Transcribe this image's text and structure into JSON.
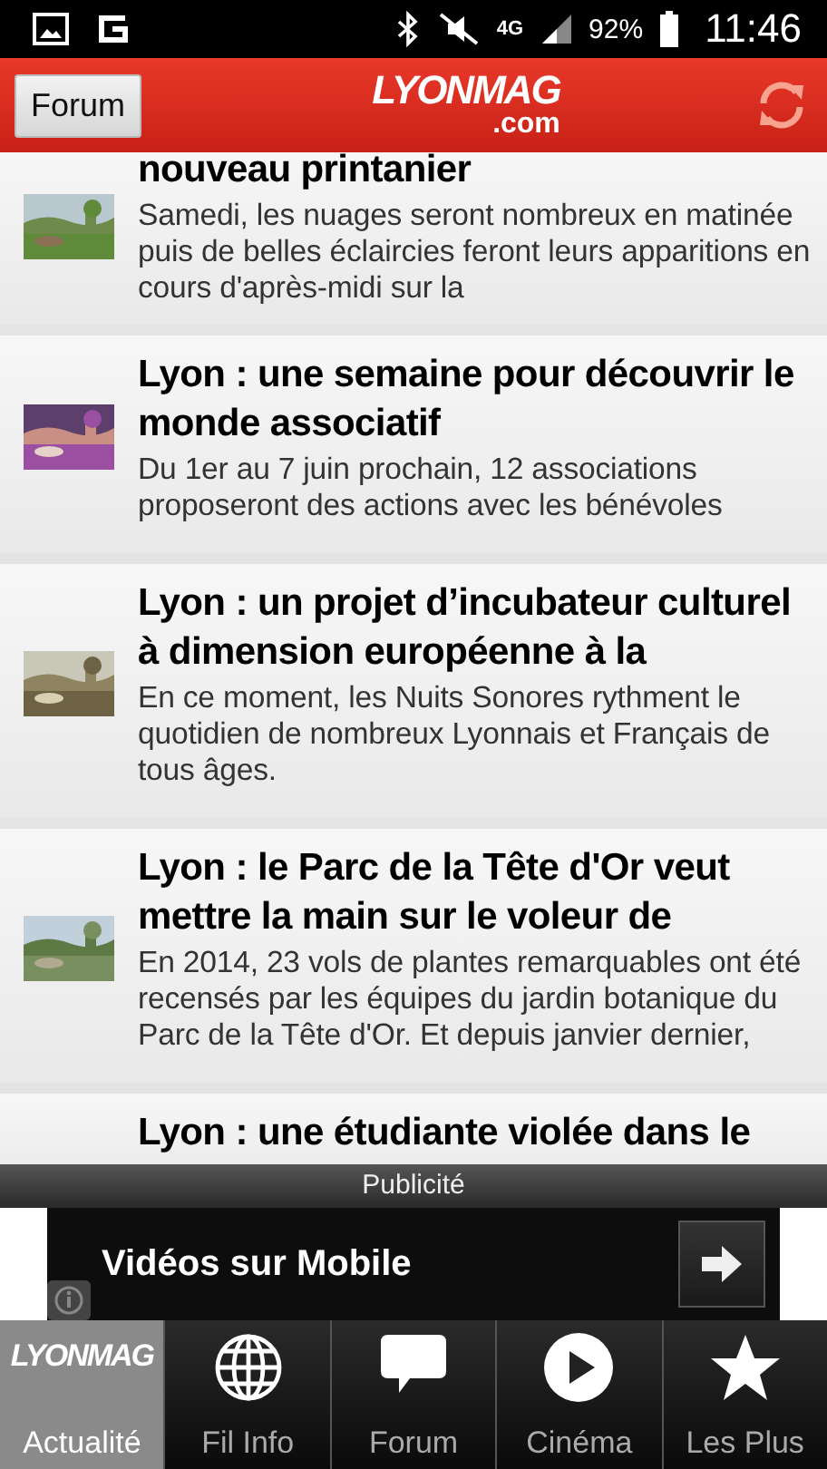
{
  "status_bar": {
    "network": "4G",
    "battery": "92%",
    "time": "11:46"
  },
  "header": {
    "button": "Forum",
    "logo_main": "LYONMAG",
    "logo_sub": ".com"
  },
  "articles": [
    {
      "title": "nouveau printanier",
      "summary": "Samedi, les nuages seront nombreux en matinée puis de belles éclaircies feront leurs apparitions en cours d'après-midi sur la"
    },
    {
      "title": "Lyon : une semaine pour découvrir le monde associatif",
      "summary": "Du 1er au 7 juin prochain, 12 associations proposeront des actions avec les bénévoles"
    },
    {
      "title": "Lyon : un projet d’incubateur culturel à dimension européenne à la",
      "summary": "En ce moment, les Nuits Sonores rythment le quotidien de nombreux Lyonnais et Français de tous âges."
    },
    {
      "title": "Lyon : le Parc de la Tête d'Or veut mettre la main sur le voleur de",
      "summary": "En 2014, 23 vols de plantes remarquables ont été recensés par les équipes du jardin botanique du Parc de la Tête d'Or. Et depuis janvier dernier,"
    },
    {
      "title": "Lyon : une étudiante violée dans le"
    }
  ],
  "ad": {
    "label": "Publicité",
    "text": "Vidéos sur Mobile"
  },
  "tabs": [
    {
      "label": "Actualité",
      "kind": "logo",
      "logo": "LYONMAG",
      "selected": true
    },
    {
      "label": "Fil Info",
      "kind": "globe",
      "selected": false
    },
    {
      "label": "Forum",
      "kind": "chat",
      "selected": false
    },
    {
      "label": "Cinéma",
      "kind": "play",
      "selected": false
    },
    {
      "label": "Les Plus",
      "kind": "star",
      "selected": false
    }
  ]
}
